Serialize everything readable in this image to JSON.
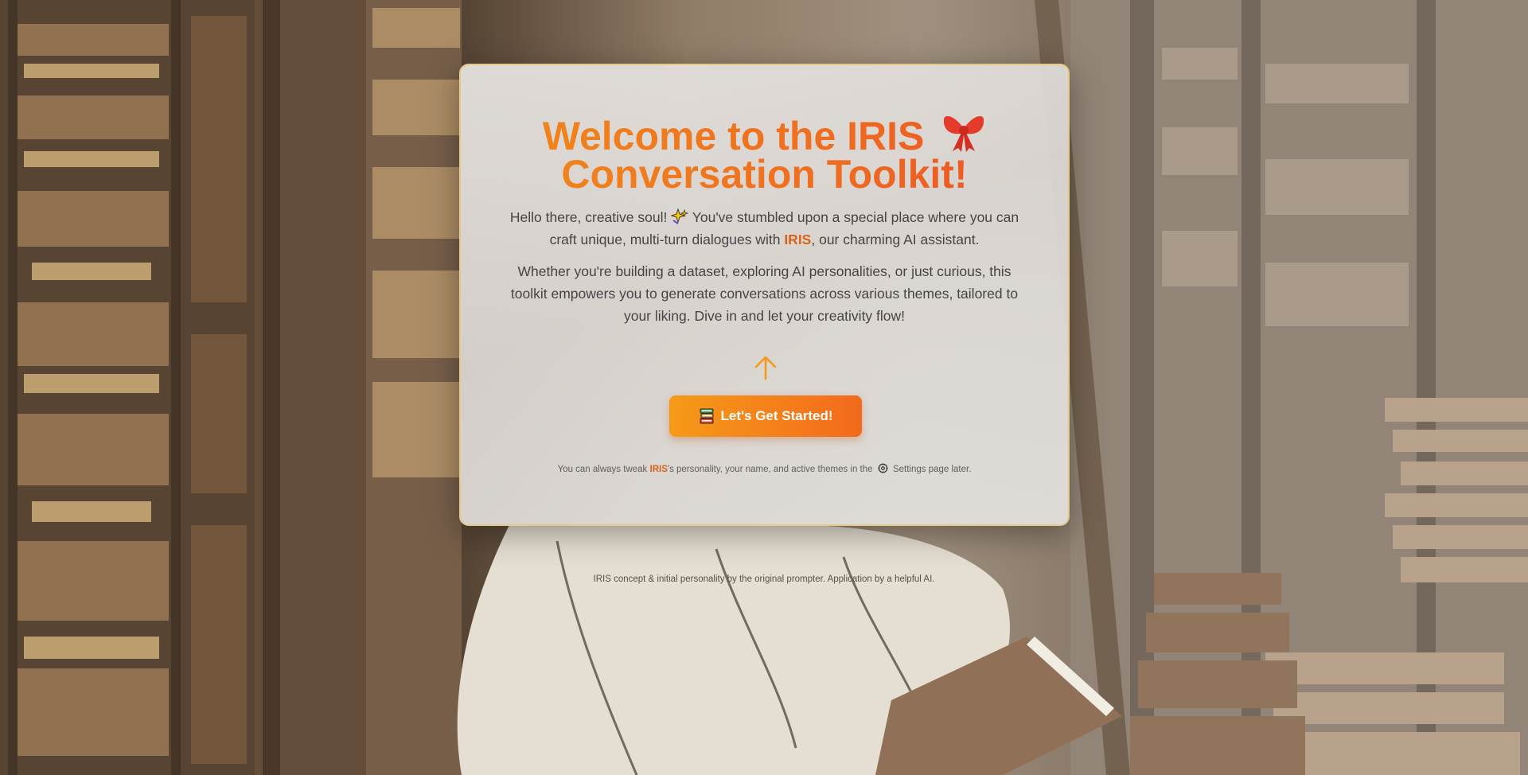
{
  "welcome": {
    "title_line1": "Welcome to the IRIS",
    "title_line2": "Conversation Toolkit!",
    "title_icon": "bow-icon",
    "intro_start": "Hello there, creative soul!",
    "intro_icon": "sparkle-icon",
    "intro_middle": "You've stumbled upon a special place where you can craft unique, multi-turn dialogues with",
    "intro_name": "IRIS",
    "intro_end": ", our charming AI assistant.",
    "paragraph2": "Whether you're building a dataset, exploring AI personalities, or just curious, this toolkit empowers you to generate conversations across various themes, tailored to your liking. Dive in and let your creativity flow!",
    "arrow_icon": "up-arrow-icon",
    "start_button_icon": "books-icon",
    "start_button_label": "Let's Get Started!",
    "note_start": "You can always tweak",
    "note_name": "IRIS",
    "note_middle": "'s personality, your name, and active themes in the",
    "note_icon": "gear-icon",
    "note_end": "Settings page later."
  },
  "footer": {
    "credit": "IRIS concept & initial personality by the original prompter. Application by a helpful AI."
  },
  "colors": {
    "accent_orange": "#f5801a",
    "title_gradient_start": "#f08a1c",
    "title_gradient_end": "#e8502a",
    "card_border": "#e3c98a"
  }
}
